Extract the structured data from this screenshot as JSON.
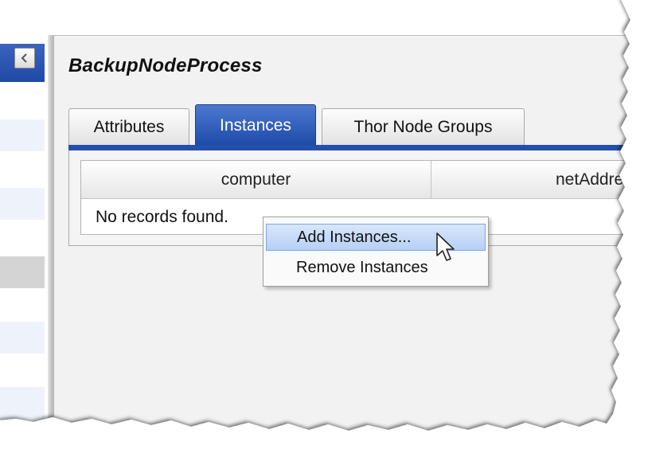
{
  "panel": {
    "title": "BackupNodeProcess",
    "tabs": [
      {
        "label": "Attributes",
        "active": false
      },
      {
        "label": "Instances",
        "active": true
      },
      {
        "label": "Thor Node Groups",
        "active": false
      }
    ]
  },
  "grid": {
    "columns": [
      "computer",
      "netAddre"
    ],
    "empty_message": "No records found."
  },
  "context_menu": {
    "items": [
      {
        "label": "Add Instances...",
        "highlighted": true
      },
      {
        "label": "Remove Instances",
        "highlighted": false
      }
    ]
  },
  "colors": {
    "accent_blue": "#244fab",
    "menu_highlight": "#b7d0f5"
  },
  "icons": {
    "collapse": "chevron-left-icon",
    "cursor": "mouse-pointer-icon"
  }
}
